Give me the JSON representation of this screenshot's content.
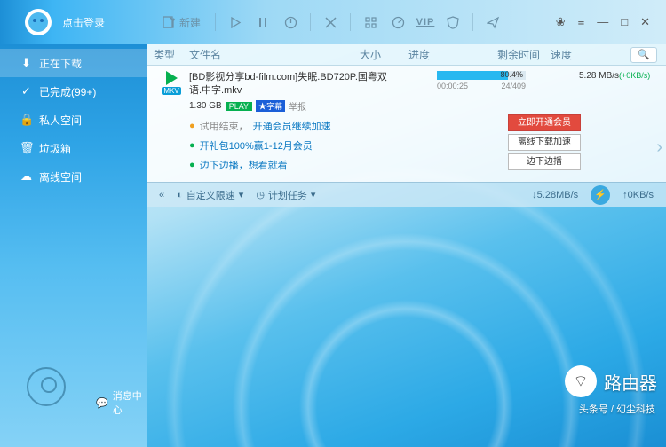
{
  "header": {
    "login": "点击登录"
  },
  "toolbar": {
    "new": "新建",
    "vip": "VIP"
  },
  "sidebar": {
    "items": [
      {
        "label": "正在下载"
      },
      {
        "label": "已完成(99+)"
      },
      {
        "label": "私人空间"
      },
      {
        "label": "垃圾箱"
      },
      {
        "label": "离线空间"
      }
    ]
  },
  "columns": {
    "type": "类型",
    "name": "文件名",
    "size": "大小",
    "progress": "进度",
    "remain": "剩余时间",
    "speed": "速度"
  },
  "task": {
    "filename": "[BD影视分享bd-film.com]失眠.BD720P.国粤双语.中字.mkv",
    "size": "1.30 GB",
    "play_badge": "PLAY",
    "subtitle_badge": "字幕",
    "rate_label": "举报",
    "format_badge": "MKV",
    "progress_pct": "80.4%",
    "progress_val": 80.4,
    "time_elapsed": "00:00:25",
    "pieces": "24/409",
    "speed_main": "5.28",
    "speed_unit": "MB/s",
    "speed_extra": "(+0KB/s)"
  },
  "promos": {
    "p1a": "试用结束，",
    "p1b": "开通会员继续加速",
    "p2a": "开礼包100%赢1-12月会员",
    "p3a": "边下边播，想看就看"
  },
  "buttons": {
    "b1": "立即开通会员",
    "b2": "离线下载加速",
    "b3": "边下边播"
  },
  "statusbar": {
    "custom_speed": "自定义限速",
    "plan": "计划任务",
    "msg": "消息中心",
    "dl_speed": "5.28MB/s",
    "up_speed": "0KB/s"
  },
  "branding": {
    "router": "路由器",
    "sub": "头条号 / 幻尘科技"
  }
}
